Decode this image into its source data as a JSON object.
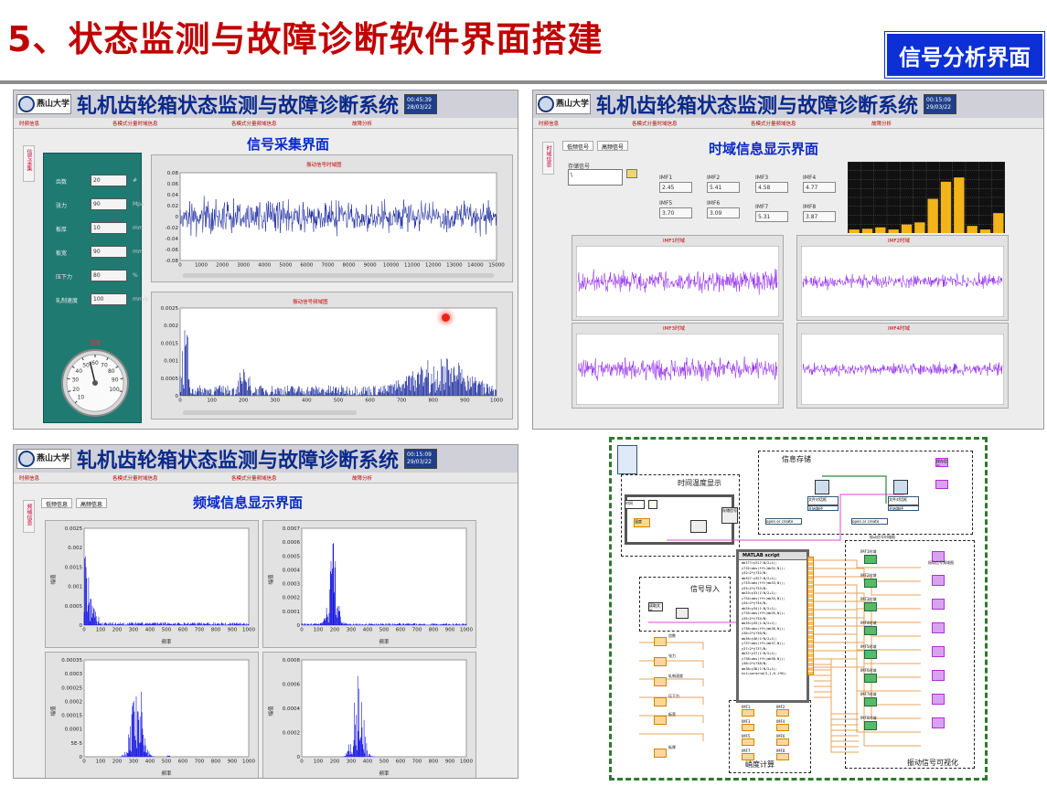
{
  "slide": {
    "title": "5、状态监测与故障诊断软件界面搭建",
    "tag": "信号分析界面"
  },
  "app": {
    "title": "轧机齿轮箱状态监测与故障诊断系统",
    "logo_text": "燕山大学",
    "logo_sub": "YANSHAN UNIVERSITY",
    "menu": [
      "时频信息",
      "各模式分量时域信息",
      "各模式分量频域信息",
      "故障分析"
    ]
  },
  "panel1": {
    "clock": [
      "00:45:39",
      "28/03/22"
    ],
    "caption": "信号采集界面",
    "side_tab": "信号采集",
    "controls": [
      {
        "label": "齿数",
        "value": "20",
        "unit": "#"
      },
      {
        "label": "张力",
        "value": "90",
        "unit": "Mpa"
      },
      {
        "label": "板厚",
        "value": "10",
        "unit": "mm"
      },
      {
        "label": "板宽",
        "value": "90",
        "unit": "mm"
      },
      {
        "label": "压下力",
        "value": "80",
        "unit": "%"
      },
      {
        "label": "轧制速度",
        "value": "100",
        "unit": "mm/s"
      }
    ],
    "gauge": {
      "label": "温度",
      "ticks": [
        "10",
        "20",
        "30",
        "40",
        "50",
        "60",
        "70",
        "80",
        "90",
        "100"
      ],
      "value": 55
    },
    "time_plot": {
      "title": "振动信号时域图",
      "yticks": [
        "0.08",
        "0.06",
        "0.04",
        "0.02",
        "0",
        "-0.02",
        "-0.04",
        "-0.06",
        "-0.08"
      ],
      "xticks": [
        "0",
        "1000",
        "2000",
        "3000",
        "4000",
        "5000",
        "6000",
        "7000",
        "8000",
        "9000",
        "10000",
        "11000",
        "12000",
        "13000",
        "14000",
        "15000"
      ]
    },
    "freq_plot": {
      "title": "振动信号频域图",
      "yticks": [
        "0.0025",
        "0.002",
        "0.0015",
        "0.001",
        "0.0005",
        "0"
      ],
      "xticks": [
        "0",
        "100",
        "200",
        "300",
        "400",
        "500",
        "600",
        "700",
        "800",
        "900",
        "1000"
      ]
    }
  },
  "panel2": {
    "clock": [
      "00:15:09",
      "29/03/22"
    ],
    "caption": "时域信息显示界面",
    "tabs": [
      "低频信号",
      "高频信号"
    ],
    "side_tab": "时域信息",
    "store_label": "存储信号",
    "imf": [
      {
        "label": "IMF1",
        "value": "2.45"
      },
      {
        "label": "IMF2",
        "value": "5.41"
      },
      {
        "label": "IMF3",
        "value": "4.58"
      },
      {
        "label": "IMF4",
        "value": "4.77"
      },
      {
        "label": "IMF5",
        "value": "3.70"
      },
      {
        "label": "IMF6",
        "value": "3.09"
      },
      {
        "label": "IMF7",
        "value": "5.31"
      },
      {
        "label": "IMF8",
        "value": "3.87"
      }
    ],
    "bar_values": [
      0.05,
      0.06,
      0.08,
      0.05,
      0.12,
      0.15,
      0.48,
      0.72,
      0.78,
      0.1,
      0.05,
      0.28
    ],
    "plots": [
      "IMF1时域",
      "IMF2时域",
      "IMF3时域",
      "IMF4时域"
    ],
    "colors": {
      "signal": "#8a1cf0",
      "bars": "#f2b418"
    }
  },
  "panel3": {
    "clock": [
      "00:15:09",
      "29/03/22"
    ],
    "caption": "频域信息显示界面",
    "tabs": [
      "低频信息",
      "高频信息"
    ],
    "side_tab": "频域信息",
    "ylabel": "幅值",
    "xlabel": "频率",
    "plots": [
      {
        "yticks": [
          "0.0025",
          "0.002",
          "0.0015",
          "0.001",
          "0.0005",
          "0"
        ]
      },
      {
        "yticks": [
          "0.0007",
          "0.0006",
          "0.0005",
          "0.0004",
          "0.0003",
          "0.0002",
          "0.0001",
          "0"
        ]
      },
      {
        "yticks": [
          "0.00035",
          "0.0003",
          "0.00025",
          "0.0002",
          "0.00015",
          "0.0001",
          "5E-5",
          "0"
        ]
      },
      {
        "yticks": [
          "0.0008",
          "0.0006",
          "0.0004",
          "0.0002",
          "0"
        ]
      }
    ],
    "xticks": [
      "0",
      "100",
      "200",
      "300",
      "400",
      "500",
      "600",
      "700",
      "800",
      "900",
      "1000"
    ]
  },
  "panel4": {
    "labels": {
      "time": "时间温度显示",
      "store": "信息存储",
      "import": "信号导入",
      "calc": "峭度计算",
      "visual": "振动信号可视化"
    },
    "script_title": "MATLAB script",
    "script_lines": [
      "mb3??=y31?:N/2+1);",
      "y?32=abs(fft(mb32,N));",
      "y32=2*y?32/N;",
      "mb32?:y32?:N/2+1);",
      "y?33=abs(fft(mb33,N));",
      "y33=2*y?33/N;",
      "mb33=y33(1:N/2+1);",
      "y?34=abs(fft(mb34,N));",
      "y34=2*y?34/N;",
      "mb34=y34(1:N/2+1);",
      "y?35=abs(fft(mb35,N));",
      "y35=2*y?35/N;",
      "mb35=y35(1:N/2+1);",
      "y?36=abs(fft(mb36,N));",
      "y36=2*y?36/N;",
      "mb36=y36(1:N/2+1);",
      "y?37=abs(fft(mb37,N));",
      "y37=2*y?37/N;",
      "mb37=y37(1:N/2+1);",
      "y?38=abs(fft(mb38,N));",
      "y38=2*y?38/N;",
      "mb38=y38(1:N/2+1);",
      "ks1=normrnd(5,1,0.1*N);"
    ],
    "imf_labels": [
      "IMF1时域",
      "IMF2时域",
      "IMF3时域",
      "IMF4时域",
      "IMF5时域",
      "IMF6时域",
      "IMF7时域",
      "IMF8时域"
    ],
    "calc_labels": [
      "IMF1",
      "IMF2",
      "IMF3",
      "IMF4",
      "IMF5",
      "IMF6",
      "IMF7",
      "IMF8"
    ],
    "file_nodes": [
      "文件对话框",
      "文件对话框"
    ],
    "file_sub": [
      "开始路径",
      "开始路径"
    ],
    "open_mode": [
      "open or create",
      "open or create"
    ],
    "misc": {
      "temp": "温度",
      "store_signal": "存储信号",
      "read_file": "读取文件",
      "gear": "齿数",
      "tension": "张力",
      "speed": "轧制速度",
      "press": "压下力",
      "width": "板宽",
      "thick": "板厚",
      "clock": "时间",
      "sigsave": "振动信号时域图",
      "freq": "振动信号频域图",
      "save": "保存信号"
    }
  }
}
